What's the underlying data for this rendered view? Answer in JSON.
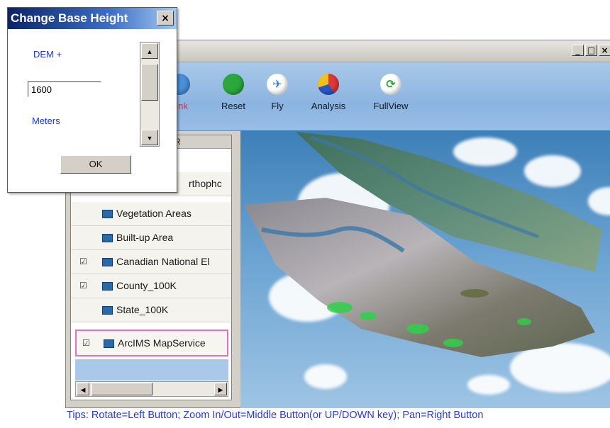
{
  "main_window": {
    "controls": {
      "minimize": "_",
      "maximize": "□",
      "close": "×"
    },
    "toolbar": [
      {
        "label": "Link",
        "icon": "link-icon",
        "color": "#4a8fd8",
        "glyph": ""
      },
      {
        "label": "Reset",
        "icon": "reset-globe-icon",
        "color": "#2aa83c",
        "glyph": ""
      },
      {
        "label": "Fly",
        "icon": "airplane-icon",
        "color": "#3a7fd0",
        "glyph": "✈"
      },
      {
        "label": "Analysis",
        "icon": "pie-chart-icon",
        "color": "#e04040",
        "glyph": ""
      },
      {
        "label": "FullView",
        "icon": "refresh-icon",
        "color": "#2aa83c",
        "glyph": "⟳"
      }
    ],
    "layer_panel": {
      "header_text": "SER",
      "layers": [
        {
          "name": "rthophc",
          "checked": "",
          "selected": false
        },
        {
          "name": "Vegetation Areas",
          "checked": "",
          "selected": false
        },
        {
          "name": "Built-up Area",
          "checked": "",
          "selected": false
        },
        {
          "name": "Canadian National El",
          "checked": "☑",
          "selected": false
        },
        {
          "name": "County_100K",
          "checked": "☑",
          "selected": false
        },
        {
          "name": "State_100K",
          "checked": "",
          "selected": false
        },
        {
          "name": "ArcIMS MapService",
          "checked": "☑",
          "selected": true
        }
      ]
    },
    "tips": "Tips: Rotate=Left Button; Zoom In/Out=Middle Button(or UP/DOWN key); Pan=Right Button"
  },
  "dialog": {
    "title": "Change Base Height",
    "close": "×",
    "source_label": "DEM +",
    "height_value": "1600",
    "unit_label": "Meters",
    "ok_label": "OK"
  },
  "colors": {
    "toolbar": "#98bde6",
    "tips_text": "#2a3bd0",
    "link_label": "#d0304a",
    "dialog_title": "#0a246a"
  }
}
